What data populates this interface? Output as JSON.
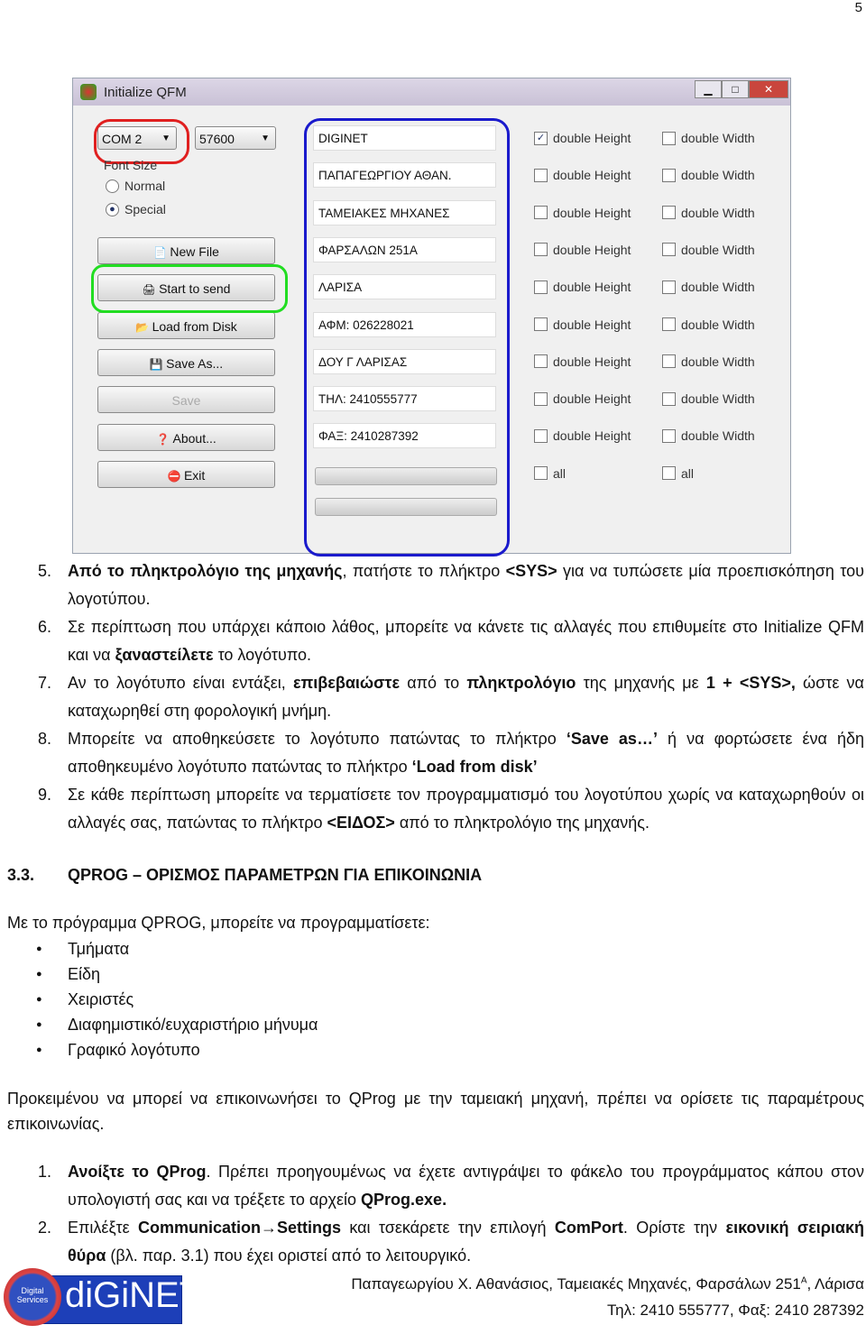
{
  "page_number": "5",
  "window": {
    "title": "Initialize QFM",
    "port": "COM 2",
    "baud": "57600",
    "font_size_label": "Font Size",
    "radio_normal": "Normal",
    "radio_special": "Special",
    "selected_font": "Special",
    "buttons": [
      "New File",
      "Start to send",
      "Load from Disk",
      "Save As...",
      "Save",
      "About...",
      "Exit"
    ],
    "fields": [
      "DIGINET",
      "ΠΑΠΑΓΕΩΡΓΙΟΥ ΑΘΑΝ.",
      "ΤΑΜΕΙΑΚΕΣ ΜΗΧΑΝΕΣ",
      "ΦΑΡΣΑΛΩΝ 251Α",
      "ΛΑΡΙΣΑ",
      "ΑΦΜ: 026228021",
      "ΔΟΥ Γ ΛΑΡΙΣΑΣ",
      "ΤΗΛ: 2410555777",
      "ΦΑΞ: 2410287392"
    ],
    "double_height": "double Height",
    "double_width": "double Width",
    "all": "all",
    "height_checked": [
      true,
      false,
      false,
      false,
      false,
      false,
      false,
      false,
      false
    ],
    "annotation_colors": {
      "port": "#e02020",
      "send": "#22dd22",
      "fields": "#1a1acc"
    }
  },
  "steps1": [
    {
      "n": "5.",
      "segs": [
        {
          "b": true,
          "t": "Από το πληκτρολόγιο της μηχανής"
        },
        {
          "t": ", πατήστε το πλήκτρο "
        },
        {
          "b": true,
          "t": "<SYS>"
        },
        {
          "t": " για να τυπώσετε μία προεπισκόπηση του λογοτύπου."
        }
      ]
    },
    {
      "n": "6.",
      "segs": [
        {
          "t": "Σε περίπτωση που υπάρχει κάποιο λάθος, μπορείτε να κάνετε τις αλλαγές που επιθυμείτε στο Initialize QFM και να "
        },
        {
          "b": true,
          "t": "ξαναστείλετε"
        },
        {
          "t": " το λογότυπο."
        }
      ]
    },
    {
      "n": "7.",
      "segs": [
        {
          "t": "Αν το λογότυπο είναι εντάξει, "
        },
        {
          "b": true,
          "t": "επιβεβαιώστε"
        },
        {
          "t": " από το "
        },
        {
          "b": true,
          "t": "πληκτρολόγιο"
        },
        {
          "t": " της μηχανής με "
        },
        {
          "b": true,
          "t": "1 + <SYS>,"
        },
        {
          "t": " ώστε να καταχωρηθεί στη φορολογική μνήμη."
        }
      ]
    },
    {
      "n": "8.",
      "segs": [
        {
          "t": "Μπορείτε να αποθηκεύσετε το λογότυπο πατώντας το πλήκτρο "
        },
        {
          "b": true,
          "t": "‘Save as…’"
        },
        {
          "t": " ή να φορτώσετε ένα ήδη αποθηκευμένο λογότυπο πατώντας το πλήκτρο "
        },
        {
          "b": true,
          "t": "‘Load from disk’"
        }
      ]
    },
    {
      "n": "9.",
      "segs": [
        {
          "t": "Σε κάθε περίπτωση μπορείτε να τερματίσετε τον προγραμματισμό του λογοτύπου χωρίς να καταχωρηθούν οι αλλαγές σας, πατώντας το πλήκτρο "
        },
        {
          "b": true,
          "t": "<ΕΙΔΟΣ>"
        },
        {
          "t": " από το πληκτρολόγιο της μηχανής."
        }
      ]
    }
  ],
  "section": {
    "number": "3.3.",
    "title": "QPROG – ΟΡΙΣΜΟΣ ΠΑΡΑΜΕΤΡΩΝ ΓΙΑ ΕΠΙΚΟΙΝΩΝΙΑ"
  },
  "intro": "Με το πρόγραμμα QPROG, μπορείτε να προγραμματίσετε:",
  "bullets": [
    "Τμήματα",
    "Είδη",
    "Χειριστές",
    "Διαφημιστικό/ευχαριστήριο μήνυμα",
    "Γραφικό λογότυπο"
  ],
  "para": "Προκειμένου να μπορεί να επικοινωνήσει το QProg με την ταμειακή μηχανή, πρέπει να ορίσετε τις παραμέτρους επικοινωνίας.",
  "steps2": [
    {
      "n": "1.",
      "segs": [
        {
          "b": true,
          "t": "Ανοίξτε το QProg"
        },
        {
          "t": ". Πρέπει προηγουμένως να έχετε αντιγράψει το φάκελο του προγράμματος κάπου στον υπολογιστή σας και να τρέξετε το αρχείο "
        },
        {
          "b": true,
          "t": "QProg.exe."
        }
      ]
    },
    {
      "n": "2.",
      "segs": [
        {
          "t": "Επιλέξτε "
        },
        {
          "b": true,
          "t": "Communication→Settings"
        },
        {
          "t": " και τσεκάρετε την επιλογή "
        },
        {
          "b": true,
          "t": "ComPort"
        },
        {
          "t": ". Ορίστε την "
        },
        {
          "b": true,
          "t": "εικονική σειριακή θύρα"
        },
        {
          "t": " (βλ. παρ. 3.1) που έχει οριστεί από το λειτουργικό."
        }
      ]
    }
  ],
  "footer": {
    "logo_small": "Digital Services",
    "logo": "diGiNET",
    "line1": "Παπαγεωργίου Χ. Αθανάσιος, Ταμειακές Μηχανές, Φαρσάλων 251",
    "sup": "Α",
    "line1_end": ", Λάρισα",
    "line2": "Τηλ: 2410 555777, Φαξ: 2410 287392"
  }
}
